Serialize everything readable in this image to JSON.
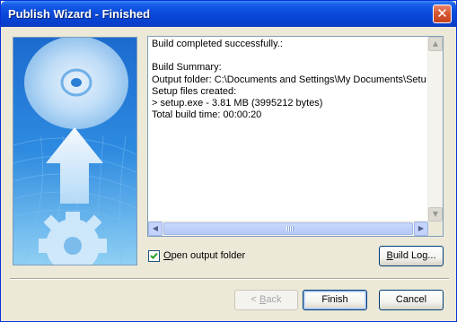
{
  "window": {
    "title": "Publish Wizard - Finished",
    "close_glyph": "✕"
  },
  "log": {
    "lines": [
      "Build completed successfully.:",
      "",
      "Build Summary:",
      "Output folder: C:\\Documents and Settings\\My Documents\\Setup",
      "Setup files created:",
      "> setup.exe - 3.81 MB (3995212 bytes)",
      "Total build time: 00:00:20"
    ]
  },
  "scrollbars": {
    "up_icon": "▲",
    "down_icon": "▼",
    "left_icon": "◀",
    "right_icon": "▶"
  },
  "options": {
    "open_output_folder": {
      "label_prefix": "",
      "label_accel": "O",
      "label_rest": "pen output folder",
      "checked": true
    }
  },
  "buttons": {
    "build_log": {
      "accel": "B",
      "rest": "uild Log..."
    },
    "back": {
      "prefix": "< ",
      "accel": "B",
      "rest": "ack"
    },
    "finish": "Finish",
    "cancel": "Cancel"
  },
  "colors": {
    "title_bar": "#0a4bdc",
    "dialog_bg": "#ece9d8",
    "art_blue": "#1a74d2",
    "close_red": "#d6552f"
  }
}
